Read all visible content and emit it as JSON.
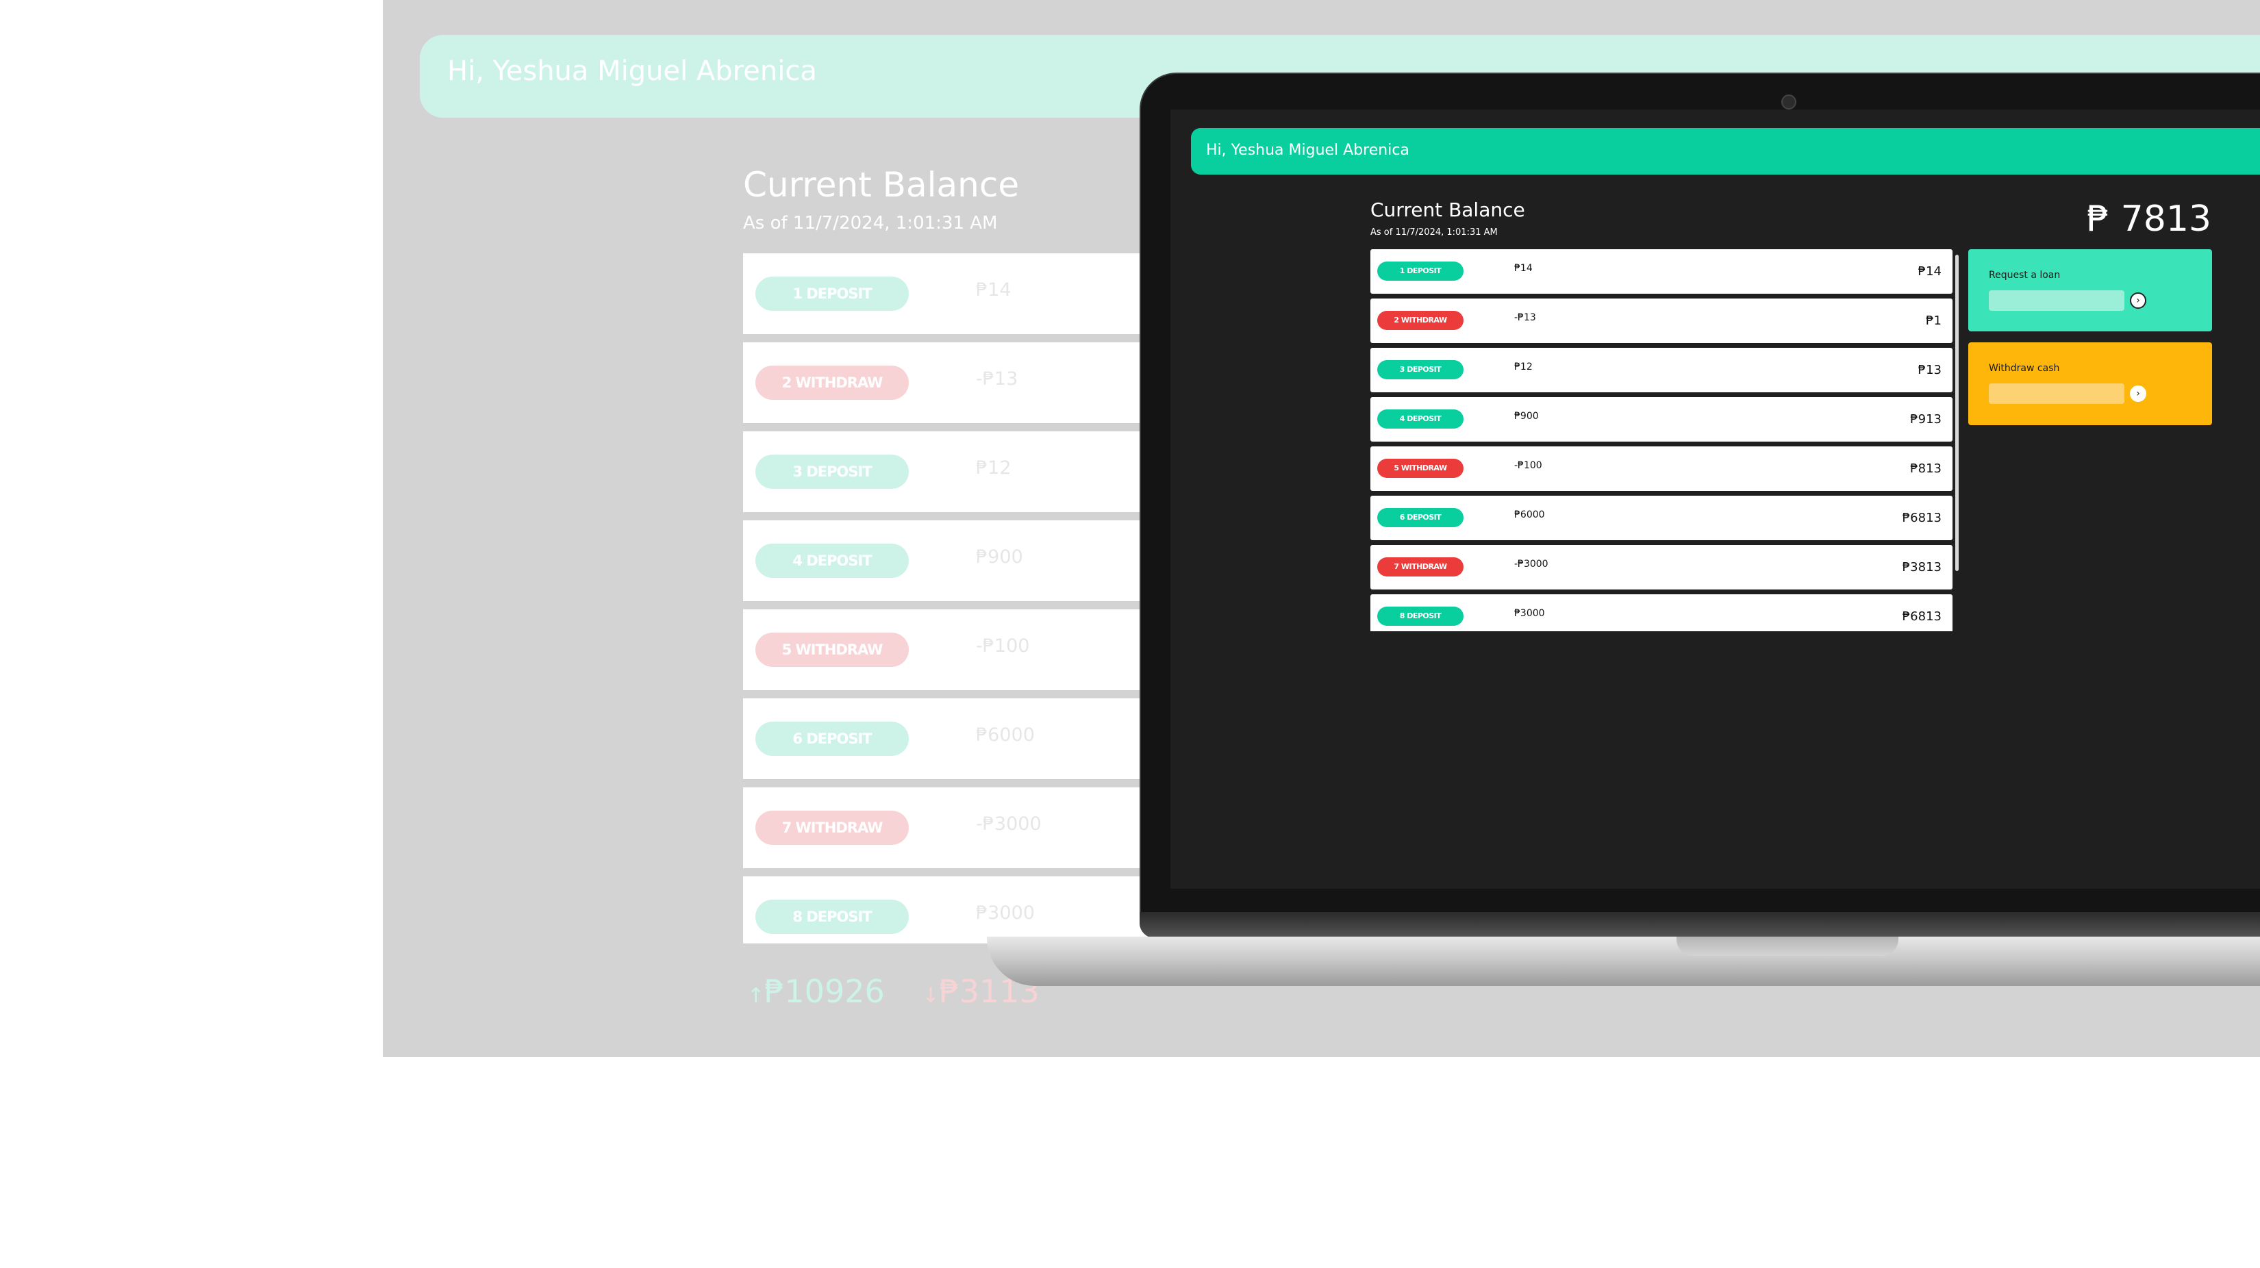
{
  "background_view": {
    "greeting": "Hi, Yeshua Miguel Abrenica",
    "title": "Current Balance",
    "subtitle": "As of 11/7/2024, 1:01:31 AM",
    "transactions": [
      {
        "label": "1 DEPOSIT",
        "type": "deposit",
        "amount": "₱14"
      },
      {
        "label": "2 WITHDRAW",
        "type": "withdraw",
        "amount": "-₱13"
      },
      {
        "label": "3 DEPOSIT",
        "type": "deposit",
        "amount": "₱12"
      },
      {
        "label": "4 DEPOSIT",
        "type": "deposit",
        "amount": "₱900"
      },
      {
        "label": "5 WITHDRAW",
        "type": "withdraw",
        "amount": "-₱100"
      },
      {
        "label": "6 DEPOSIT",
        "type": "deposit",
        "amount": "₱6000"
      },
      {
        "label": "7 WITHDRAW",
        "type": "withdraw",
        "amount": "-₱3000"
      },
      {
        "label": "8 DEPOSIT",
        "type": "deposit",
        "amount": "₱3000"
      }
    ],
    "totals": {
      "in_arrow": "↑",
      "in_value": "₱10926",
      "out_arrow": "↓",
      "out_value": "₱3113"
    }
  },
  "screen": {
    "greeting": "Hi, Yeshua Miguel Abrenica",
    "title": "Current Balance",
    "subtitle": "As of 11/7/2024, 1:01:31 AM",
    "balance": "₱ 7813",
    "transactions": [
      {
        "label": "1 DEPOSIT",
        "type": "deposit",
        "change": "₱14",
        "balance": "₱14"
      },
      {
        "label": "2 WITHDRAW",
        "type": "withdraw",
        "change": "-₱13",
        "balance": "₱1"
      },
      {
        "label": "3 DEPOSIT",
        "type": "deposit",
        "change": "₱12",
        "balance": "₱13"
      },
      {
        "label": "4 DEPOSIT",
        "type": "deposit",
        "change": "₱900",
        "balance": "₱913"
      },
      {
        "label": "5 WITHDRAW",
        "type": "withdraw",
        "change": "-₱100",
        "balance": "₱813"
      },
      {
        "label": "6 DEPOSIT",
        "type": "deposit",
        "change": "₱6000",
        "balance": "₱6813"
      },
      {
        "label": "7 WITHDRAW",
        "type": "withdraw",
        "change": "-₱3000",
        "balance": "₱3813"
      },
      {
        "label": "8 DEPOSIT",
        "type": "deposit",
        "change": "₱3000",
        "balance": "₱6813"
      }
    ],
    "loan_card": {
      "title": "Request a loan",
      "button_icon": "›",
      "icon_name": "chevron-right-icon"
    },
    "cash_card": {
      "title": "Withdraw cash",
      "button_icon": "›",
      "icon_name": "chevron-right-icon"
    }
  },
  "colors": {
    "deposit": "#09cf9f",
    "withdraw": "#eb3b3b",
    "loan_card": "#3ae3b8",
    "cash_card": "#ffb60a",
    "screen_bg": "#1f1f1f",
    "faded_panel": "#d3d3d3"
  }
}
